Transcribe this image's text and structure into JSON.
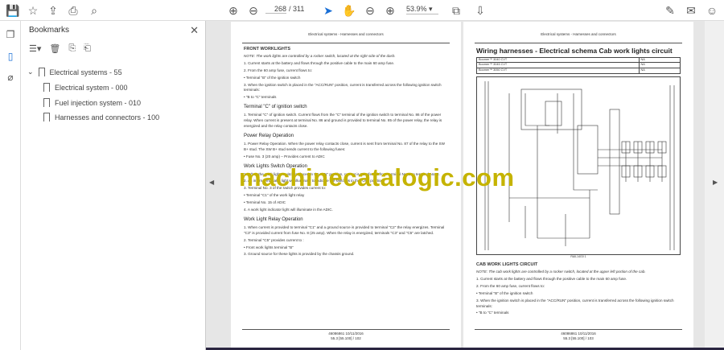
{
  "toolbar": {
    "page_current": "268",
    "page_total": "/ 311",
    "zoom": "53.9%"
  },
  "bookmarks": {
    "title": "Bookmarks",
    "items": [
      {
        "label": "Electrical systems - 55",
        "level": 0
      },
      {
        "label": "Electrical system - 000",
        "level": 1
      },
      {
        "label": "Fuel injection system - 010",
        "level": 1
      },
      {
        "label": "Harnesses and connectors - 100",
        "level": 1
      }
    ]
  },
  "left_page": {
    "header": "Electrical systems - Harnesses and connectors",
    "s1_title": "FRONT WORKLIGHTS",
    "s1_note": "NOTE: The work lights are controlled by a rocker switch, located at the right side of the dash.",
    "s1_items": [
      "1.  Current starts at the battery and flows through the positive cable to the main 60 amp fuse.",
      "2.  From the 60 amp fuse, current flows to:",
      "•  Terminal \"B\" of the ignition switch",
      "3.  When the ignition switch is placed in the \"ACC/RUN\" position, current is transferred across the following ignition switch terminals:",
      "•  \"B to \"C\" terminals"
    ],
    "s2_title": "Terminal \"C\" of ignition switch",
    "s2_items": [
      "1.  Terminal \"C\" of ignition switch. Current flows from the \"C\" terminal of the ignition switch to terminal No. 86 of the power relay. When current is present at terminal No. 86 and ground is provided to terminal No. 85 of the power relay, the relay is energized and the relay contacts close."
    ],
    "s3_title": "Power Relay Operation",
    "s3_items": [
      "1.  Power Relay Operation. When the power relay contacts close, current is sent from terminal No. 87 of the relay to the SW B+ stud. The SW B+ stud sends current to the following fuses:",
      "•  Fuse No. 3 (20 amp) – Provides current to ADIC"
    ],
    "s4_title": "Work Lights Switch Operation",
    "s4_items": [
      "1.  When the work lights switch is placed in the \"ON\" position, current is transferred from terminal No. 2 to terminal No. 3.",
      "2.  An internal indicator light will illuminate to indicate the switch is in the \"ON\" position.",
      "3.  Terminal No. 3 of the switch provides current to:",
      "•  Terminal \"C1\" of the work light relay",
      "•  Terminal No. 15 of ADIC",
      "4.  A work light indicator light will illuminate in the ADIC."
    ],
    "s5_title": "Work Light Relay Operation",
    "s5_items": [
      "1.  When current is provided to terminal \"C1\" and a ground source is provided to terminal \"C2\" the relay energizes. Terminal \"C3\" is provided current from fuse No. 8 (25 amp). When the relay is energized, terminals \"C3\" and \"C5\" are latched.",
      "2.  Terminal \"C5\" provides current to :",
      "•  Front work lights terminal \"B\"",
      "3.  Ground source for these lights is provided by the chassis ground."
    ],
    "footer1": "46086861 10/11/2016",
    "footer2": "55.3 [55.100] / 102"
  },
  "right_page": {
    "header": "Electrical systems - Harnesses and connectors",
    "title": "Wiring harnesses - Electrical schema Cab work lights circuit",
    "models": [
      [
        "Boomer™ 3040 CVT",
        "NA"
      ],
      [
        "Boomer™ 3045 CVT",
        "NA"
      ],
      [
        "Boomer™ 3050 CVT",
        "NA"
      ]
    ],
    "figure_ref": "RAIL14G0   1",
    "s1_title": "CAB WORK LIGHTS CIRCUIT",
    "s1_note": "NOTE: The cab work lights are controlled by a rocker switch, located at the upper left portion of the cab.",
    "s1_items": [
      "1.  Current starts at the battery and flows through the positive cable to the main 60 amp fuse.",
      "2.  From the 60 amp fuse, current flows to:",
      "•  Terminal \"B\" of the ignition switch",
      "3.  When the ignition switch is placed in the \"ACC/RUN\" position, current is transferred across the following ignition switch terminals:",
      "•  \"B to \"C\" terminals"
    ],
    "footer1": "46086861 10/11/2016",
    "footer2": "55.3 [55.100] / 103"
  },
  "watermark": "machinecatalogic.com"
}
